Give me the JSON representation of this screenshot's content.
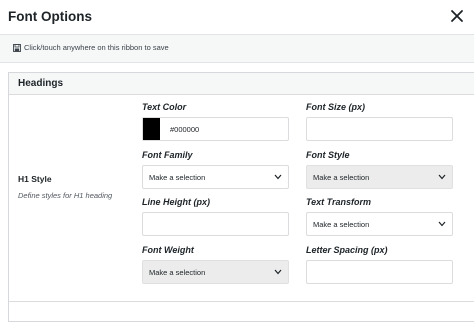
{
  "header": {
    "title": "Font Options",
    "close_icon": "close-icon"
  },
  "ribbon": {
    "icon": "save-icon",
    "text": "Click/touch anywhere on this ribbon to save"
  },
  "section": {
    "title": "Headings"
  },
  "row": {
    "label": "H1 Style",
    "description": "Define styles for H1 heading"
  },
  "fields": {
    "text_color": {
      "label": "Text Color",
      "value": "#000000",
      "swatch": "#000000"
    },
    "font_size": {
      "label": "Font Size (px)",
      "value": ""
    },
    "font_family": {
      "label": "Font Family",
      "selected": "Make a selection"
    },
    "font_style": {
      "label": "Font Style",
      "selected": "Make a selection"
    },
    "line_height": {
      "label": "Line Height (px)",
      "value": ""
    },
    "text_transform": {
      "label": "Text Transform",
      "selected": "Make a selection"
    },
    "font_weight": {
      "label": "Font Weight",
      "selected": "Make a selection"
    },
    "letter_spacing": {
      "label": "Letter Spacing (px)",
      "value": ""
    }
  }
}
